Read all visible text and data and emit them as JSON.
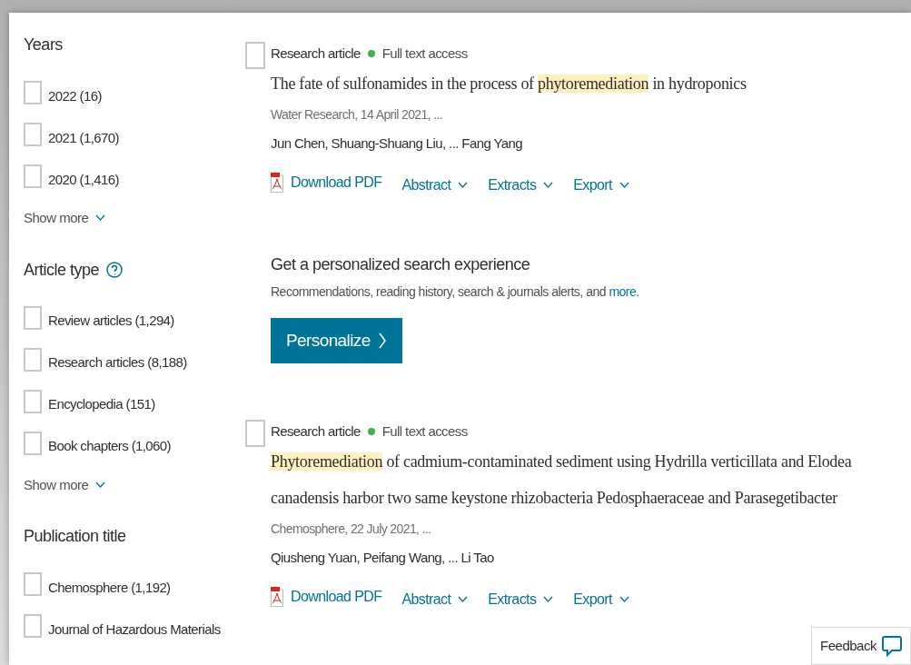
{
  "filters": [
    {
      "heading": "Years",
      "help": false,
      "options": [
        {
          "label": "2022 (16)",
          "checked": false
        },
        {
          "label": "2021 (1,670)",
          "checked": false
        },
        {
          "label": "2020 (1,416)",
          "checked": false
        }
      ],
      "show_more": "Show more"
    },
    {
      "heading": "Article type",
      "help": true,
      "options": [
        {
          "label": "Review articles (1,294)",
          "checked": false
        },
        {
          "label": "Research articles (8,188)",
          "checked": false
        },
        {
          "label": "Encyclopedia (151)",
          "checked": false
        },
        {
          "label": "Book chapters (1,060)",
          "checked": false
        }
      ],
      "show_more": "Show more"
    },
    {
      "heading": "Publication title",
      "help": false,
      "options": [
        {
          "label": "Chemosphere (1,192)",
          "checked": false
        },
        {
          "label": "Journal of Hazardous Materials",
          "checked": false
        }
      ]
    }
  ],
  "results": [
    {
      "kind": "article",
      "checked": false,
      "type": "Research article",
      "access": "Full text access",
      "title": [
        {
          "text": "The fate of sulfonamides in the process of ",
          "highlight": false
        },
        {
          "text": "phytoremediation",
          "highlight": true
        },
        {
          "text": " in hydroponics",
          "highlight": false
        }
      ],
      "source": "Water Research, 14 April 2021, ...",
      "authors": "Jun Chen, Shuang-Shuang Liu, ... Fang Yang",
      "actions": [
        "Download PDF",
        "Abstract",
        "Extracts",
        "Export"
      ]
    },
    {
      "kind": "promo",
      "heading": "Get a personalized search experience",
      "text": "Recommendations, reading history, search & journals alerts, and ",
      "link": "more.",
      "button": "Personalize"
    },
    {
      "kind": "article",
      "checked": false,
      "type": "Research article",
      "access": "Full text access",
      "title": [
        {
          "text": "Phytoremediation",
          "highlight": true
        },
        {
          "text": " of cadmium-contaminated sediment using Hydrilla verticillata and Elodea canadensis harbor two same keystone rhizobacteria Pedosphaeraceae and Parasegetibacter",
          "highlight": false
        }
      ],
      "source": "Chemosphere, 22 July 2021, ...",
      "authors": "Qiusheng Yuan, Peifang Wang, ... Li Tao",
      "actions": [
        "Download PDF",
        "Abstract",
        "Extracts",
        "Export"
      ]
    }
  ],
  "feedback": "Feedback"
}
